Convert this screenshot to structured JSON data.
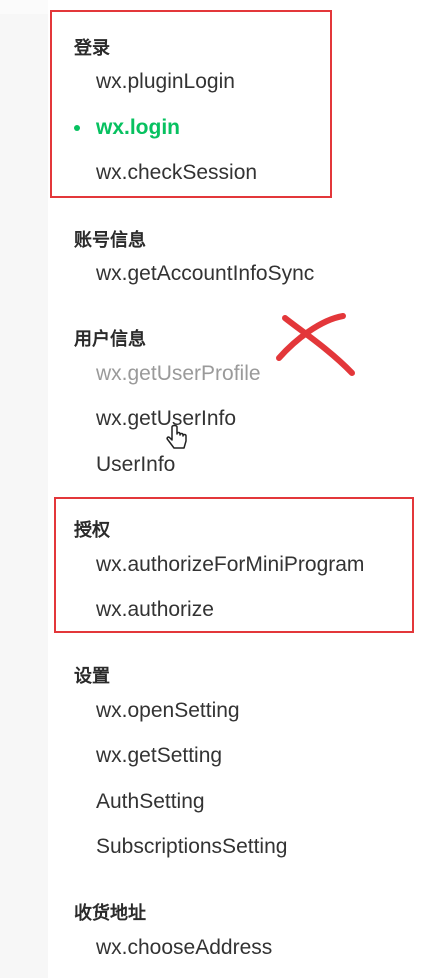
{
  "sections": {
    "login": {
      "title": "登录",
      "items": [
        "wx.pluginLogin",
        "wx.login",
        "wx.checkSession"
      ]
    },
    "account_info": {
      "title": "账号信息",
      "items": [
        "wx.getAccountInfoSync"
      ]
    },
    "user_info": {
      "title": "用户信息",
      "items": [
        "wx.getUserProfile",
        "wx.getUserInfo",
        "UserInfo"
      ]
    },
    "authorize": {
      "title": "授权",
      "items": [
        "wx.authorizeForMiniProgram",
        "wx.authorize"
      ]
    },
    "settings": {
      "title": "设置",
      "items": [
        "wx.openSetting",
        "wx.getSetting",
        "AuthSetting",
        "SubscriptionsSetting"
      ]
    },
    "address": {
      "title": "收货地址",
      "items": [
        "wx.chooseAddress"
      ]
    }
  },
  "active_item": "wx.login",
  "colors": {
    "active": "#07c160",
    "annotation": "#e3373a",
    "deprecated": "#9a9a9a"
  },
  "icons": [
    "bullet-icon",
    "hand-cursor-icon",
    "cross-mark-icon"
  ]
}
